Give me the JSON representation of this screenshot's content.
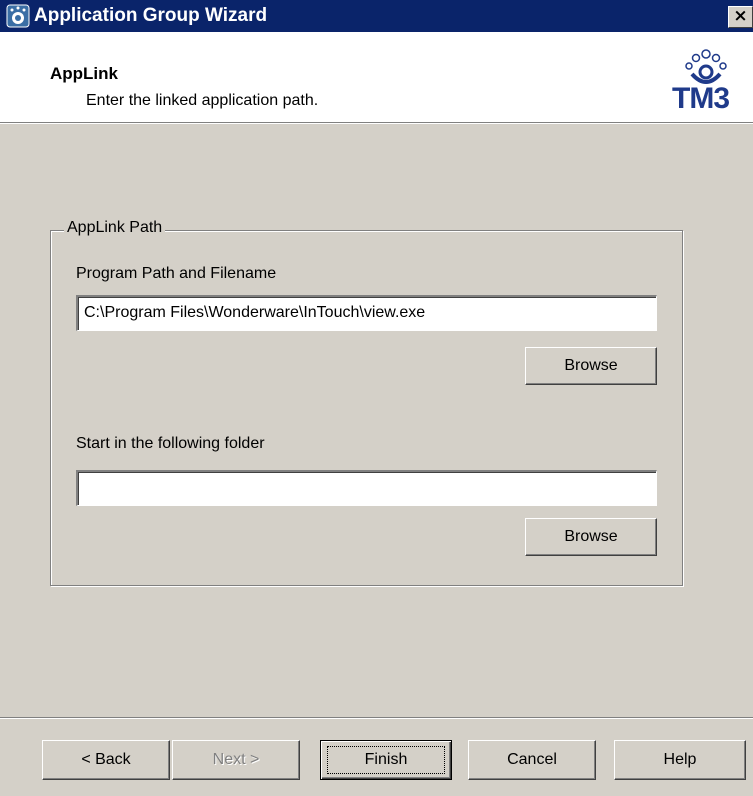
{
  "window": {
    "title": "Application Group Wizard",
    "close_glyph": "×"
  },
  "header": {
    "title": "AppLink",
    "subtitle": "Enter the linked application path.",
    "logo_text": "TM3"
  },
  "group": {
    "legend": "AppLink Path",
    "program_label": "Program Path and Filename",
    "program_value": "C:\\Program Files\\Wonderware\\InTouch\\view.exe",
    "browse1_label": "Browse",
    "start_label": "Start in the following folder",
    "start_value": "",
    "browse2_label": "Browse"
  },
  "footer": {
    "back_label": "< Back",
    "next_label": "Next >",
    "finish_label": "Finish",
    "cancel_label": "Cancel",
    "help_label": "Help"
  },
  "colors": {
    "titlebar": "#0a246a",
    "face": "#d4d0c8",
    "logo": "#1f3a8a"
  }
}
